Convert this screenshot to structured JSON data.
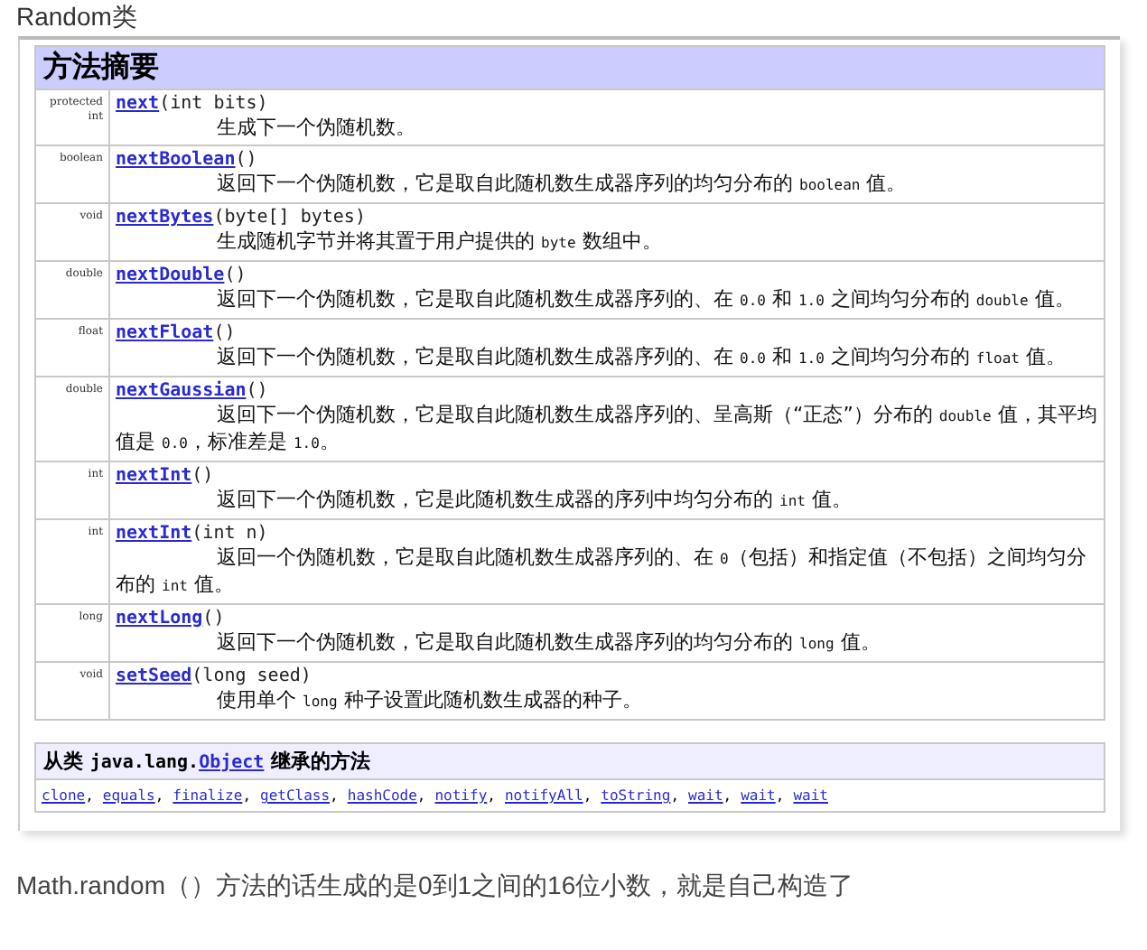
{
  "title": "Random类",
  "summary": {
    "heading": "方法摘要",
    "rows": [
      {
        "type": "protected int",
        "method": "next",
        "params": "(int bits)",
        "description": [
          {
            "kind": "text",
            "text": "生成下一个伪随机数。"
          }
        ]
      },
      {
        "type": "boolean",
        "method": "nextBoolean",
        "params": "()",
        "description": [
          {
            "kind": "text",
            "text": "返回下一个伪随机数，它是取自此随机数生成器序列的均匀分布的 "
          },
          {
            "kind": "code",
            "text": "boolean"
          },
          {
            "kind": "text",
            "text": " 值。"
          }
        ]
      },
      {
        "type": "void",
        "method": "nextBytes",
        "params": "(byte[] bytes)",
        "description": [
          {
            "kind": "text",
            "text": "生成随机字节并将其置于用户提供的 "
          },
          {
            "kind": "code",
            "text": "byte"
          },
          {
            "kind": "text",
            "text": " 数组中。"
          }
        ]
      },
      {
        "type": "double",
        "method": "nextDouble",
        "params": "()",
        "description": [
          {
            "kind": "text",
            "text": "返回下一个伪随机数，它是取自此随机数生成器序列的、在 "
          },
          {
            "kind": "code",
            "text": "0.0"
          },
          {
            "kind": "text",
            "text": " 和 "
          },
          {
            "kind": "code",
            "text": "1.0"
          },
          {
            "kind": "text",
            "text": " 之间均匀分布的 "
          },
          {
            "kind": "code",
            "text": "double"
          },
          {
            "kind": "text",
            "text": " 值。"
          }
        ]
      },
      {
        "type": "float",
        "method": "nextFloat",
        "params": "()",
        "description": [
          {
            "kind": "text",
            "text": "返回下一个伪随机数，它是取自此随机数生成器序列的、在 "
          },
          {
            "kind": "code",
            "text": "0.0"
          },
          {
            "kind": "text",
            "text": " 和 "
          },
          {
            "kind": "code",
            "text": "1.0"
          },
          {
            "kind": "text",
            "text": " 之间均匀分布的 "
          },
          {
            "kind": "code",
            "text": "float"
          },
          {
            "kind": "text",
            "text": " 值。"
          }
        ]
      },
      {
        "type": "double",
        "method": "nextGaussian",
        "params": "()",
        "description": [
          {
            "kind": "text",
            "text": "返回下一个伪随机数，它是取自此随机数生成器序列的、呈高斯（“正态”）分布的 "
          },
          {
            "kind": "code",
            "text": "double"
          },
          {
            "kind": "text",
            "text": " 值，其平均值是 "
          },
          {
            "kind": "code",
            "text": "0.0"
          },
          {
            "kind": "text",
            "text": "，标准差是 "
          },
          {
            "kind": "code",
            "text": "1.0"
          },
          {
            "kind": "text",
            "text": "。"
          }
        ]
      },
      {
        "type": "int",
        "method": "nextInt",
        "params": "()",
        "description": [
          {
            "kind": "text",
            "text": "返回下一个伪随机数，它是此随机数生成器的序列中均匀分布的 "
          },
          {
            "kind": "code",
            "text": "int"
          },
          {
            "kind": "text",
            "text": " 值。"
          }
        ]
      },
      {
        "type": "int",
        "method": "nextInt",
        "params": "(int n)",
        "description": [
          {
            "kind": "text",
            "text": "返回一个伪随机数，它是取自此随机数生成器序列的、在 "
          },
          {
            "kind": "code",
            "text": "0"
          },
          {
            "kind": "text",
            "text": "（包括）和指定值（不包括）之间均匀分布的 "
          },
          {
            "kind": "code",
            "text": "int"
          },
          {
            "kind": "text",
            "text": " 值。"
          }
        ]
      },
      {
        "type": "long",
        "method": "nextLong",
        "params": "()",
        "description": [
          {
            "kind": "text",
            "text": "返回下一个伪随机数，它是取自此随机数生成器序列的均匀分布的 "
          },
          {
            "kind": "code",
            "text": "long"
          },
          {
            "kind": "text",
            "text": " 值。"
          }
        ]
      },
      {
        "type": "void",
        "method": "setSeed",
        "params": "(long seed)",
        "description": [
          {
            "kind": "text",
            "text": "使用单个 "
          },
          {
            "kind": "code",
            "text": "long"
          },
          {
            "kind": "text",
            "text": " 种子设置此随机数生成器的种子。"
          }
        ]
      }
    ]
  },
  "inherited": {
    "prefix": "从类",
    "package": "java.lang.",
    "class_link": "Object",
    "suffix": "继承的方法",
    "separator": ",",
    "methods": [
      "clone",
      "equals",
      "finalize",
      "getClass",
      "hashCode",
      "notify",
      "notifyAll",
      "toString",
      "wait",
      "wait",
      "wait"
    ]
  },
  "note": "Math.random（）方法的话生成的是0到1之间的16位小数，就是自己构造了"
}
